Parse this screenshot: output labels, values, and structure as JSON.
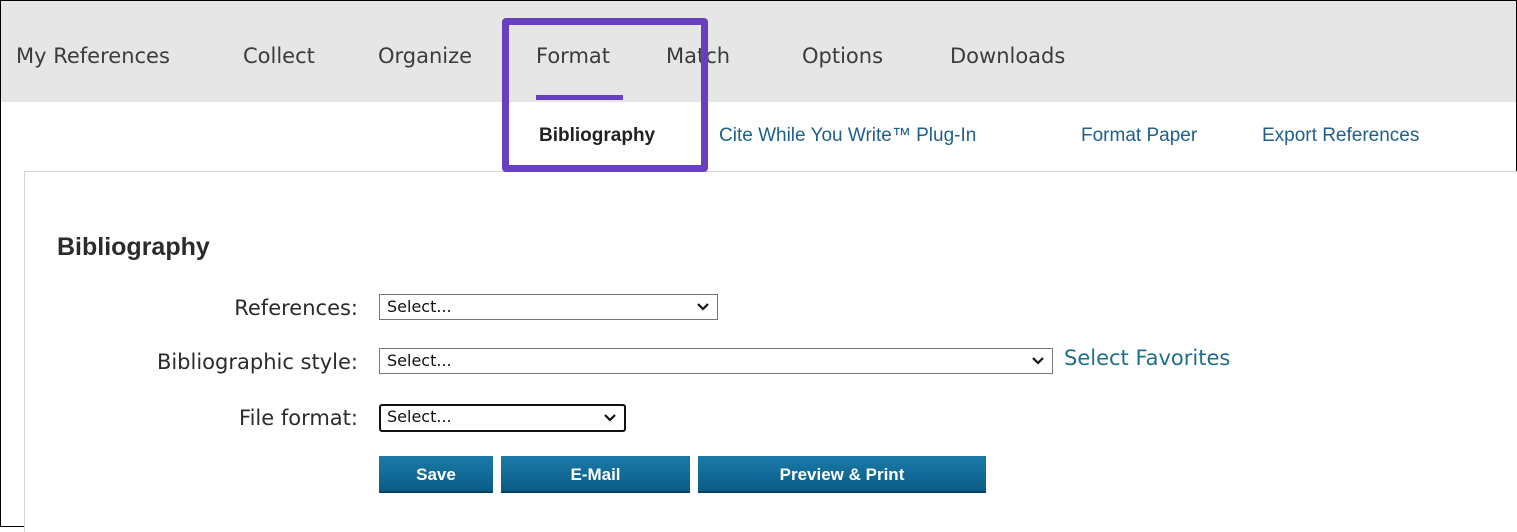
{
  "top_nav": {
    "items": [
      {
        "label": "My References"
      },
      {
        "label": "Collect"
      },
      {
        "label": "Organize"
      },
      {
        "label": "Format"
      },
      {
        "label": "Match"
      },
      {
        "label": "Options"
      },
      {
        "label": "Downloads"
      }
    ],
    "active": "Format"
  },
  "sub_nav": {
    "items": [
      {
        "label": "Bibliography"
      },
      {
        "label": "Cite While You Write™ Plug-In"
      },
      {
        "label": "Format Paper"
      },
      {
        "label": "Export References"
      }
    ],
    "active": "Bibliography"
  },
  "form": {
    "heading": "Bibliography",
    "references": {
      "label": "References:",
      "value": "Select..."
    },
    "style": {
      "label": "Bibliographic style:",
      "value": "Select...",
      "favorites_link": "Select Favorites"
    },
    "file_format": {
      "label": "File format:",
      "value": "Select..."
    }
  },
  "buttons": {
    "save": "Save",
    "email": "E-Mail",
    "preview": "Preview & Print"
  },
  "colors": {
    "accent": "#6a3fbf",
    "link": "#1e5f8c",
    "button": "#0b5c87",
    "nav_bg": "#e6e6e6"
  },
  "icons": [
    "chevron-down-icon"
  ]
}
